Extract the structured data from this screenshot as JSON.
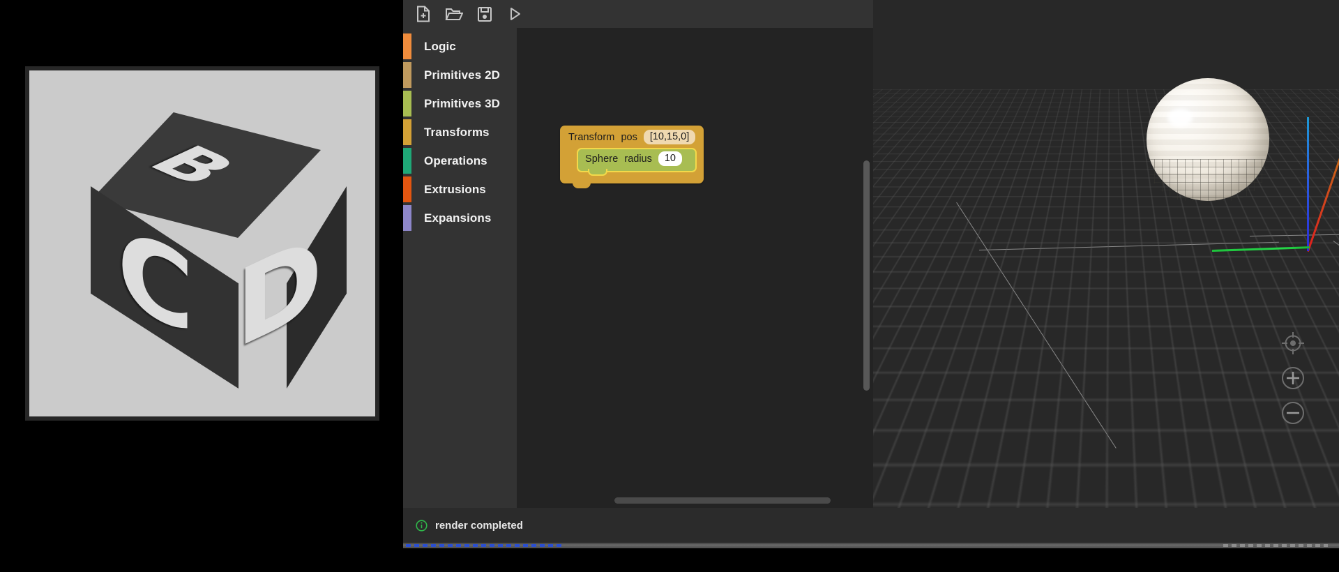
{
  "preview": {
    "name": "render-preview",
    "background_color": "#cbcbcb",
    "cube": {
      "top_letter": "B",
      "left_letter": "C",
      "right_letter": "D",
      "body_color": "#333333",
      "letter_color": "#dddddd"
    }
  },
  "toolbar": {
    "buttons": [
      {
        "name": "new-file",
        "icon": "new-file-icon",
        "label": "New"
      },
      {
        "name": "open-file",
        "icon": "open-folder-icon",
        "label": "Open"
      },
      {
        "name": "save-file",
        "icon": "save-disk-icon",
        "label": "Save"
      },
      {
        "name": "run",
        "icon": "play-icon",
        "label": "Run"
      }
    ]
  },
  "sidebar": {
    "items": [
      {
        "label": "Logic",
        "color": "#f08c3c"
      },
      {
        "label": "Primitives 2D",
        "color": "#c09a5e"
      },
      {
        "label": "Primitives 3D",
        "color": "#a8bd52"
      },
      {
        "label": "Transforms",
        "color": "#d3a136"
      },
      {
        "label": "Operations",
        "color": "#1fa877"
      },
      {
        "label": "Extrusions",
        "color": "#e25510"
      },
      {
        "label": "Expansions",
        "color": "#8d86c9"
      }
    ]
  },
  "canvas": {
    "blocks": [
      {
        "name": "transform-block",
        "title": "Transform",
        "color": "#d3a136",
        "fields": [
          {
            "label": "pos",
            "value": "[10,15,0]",
            "style": "tan"
          }
        ],
        "child": {
          "name": "sphere-block",
          "title": "Sphere",
          "color": "#a8bd52",
          "selected": true,
          "highlight_color": "#f3d94a",
          "fields": [
            {
              "label": "radius",
              "value": "10",
              "style": "white"
            }
          ]
        }
      }
    ]
  },
  "viewport": {
    "name": "3d-viewport",
    "background_color": "#282828",
    "axes": [
      {
        "name": "z-axis",
        "color": "#2b2bd8"
      },
      {
        "name": "x-axis",
        "color": "#e01d1d"
      },
      {
        "name": "y-axis",
        "color": "#27d94a"
      }
    ],
    "object": {
      "name": "sphere-mesh",
      "color": "#efe9de"
    },
    "controls": [
      {
        "name": "center-view-button",
        "icon": "crosshair-icon"
      },
      {
        "name": "zoom-in-button",
        "icon": "plus-circle-icon"
      },
      {
        "name": "zoom-out-button",
        "icon": "minus-circle-icon"
      }
    ]
  },
  "statusbar": {
    "icon": "info-circle-icon",
    "icon_color": "#2fb84a",
    "message": "render completed"
  }
}
